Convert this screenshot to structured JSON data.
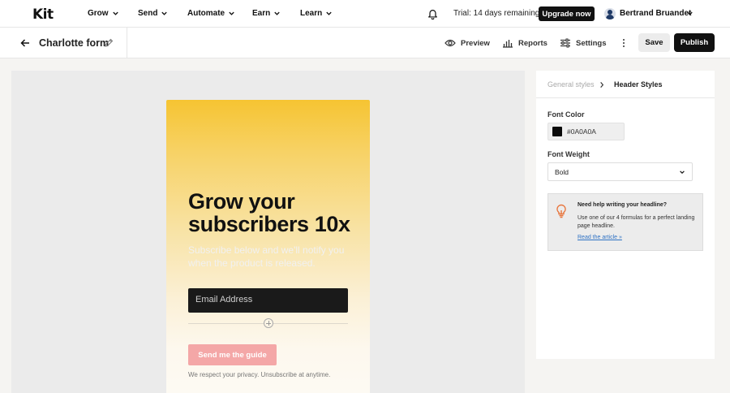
{
  "brand": {
    "logo": "Kit"
  },
  "nav": {
    "items": [
      {
        "label": "Grow"
      },
      {
        "label": "Send"
      },
      {
        "label": "Automate"
      },
      {
        "label": "Earn"
      },
      {
        "label": "Learn"
      }
    ],
    "trial_text": "Trial: 14 days remaining",
    "upgrade_label": "Upgrade now",
    "user_name": "Bertrand Bruandet"
  },
  "toolbar": {
    "form_title": "Charlotte form",
    "preview_label": "Preview",
    "reports_label": "Reports",
    "settings_label": "Settings",
    "save_label": "Save",
    "publish_label": "Publish"
  },
  "form": {
    "headline": "Grow your subscribers 10x",
    "subtext": "Subscribe below and we'll notify you when the product is released.",
    "email_placeholder": "Email Address",
    "button_label": "Send me the guide",
    "privacy_text": "We respect your privacy. Unsubscribe at anytime."
  },
  "panel": {
    "breadcrumb_parent": "General styles",
    "breadcrumb_current": "Header Styles",
    "font_color_label": "Font Color",
    "font_color_value": "#0A0A0A",
    "font_weight_label": "Font Weight",
    "font_weight_value": "Bold",
    "tip_title": "Need help writing your headline?",
    "tip_body": "Use one of our 4 formulas for a perfect landing page headline.",
    "tip_link": "Read the article »"
  },
  "colors": {
    "form_gradient_top": "#f6c432",
    "button_pink": "#f4a7a7",
    "link_blue": "#2f72c4",
    "bulb_orange": "#e8743b"
  }
}
